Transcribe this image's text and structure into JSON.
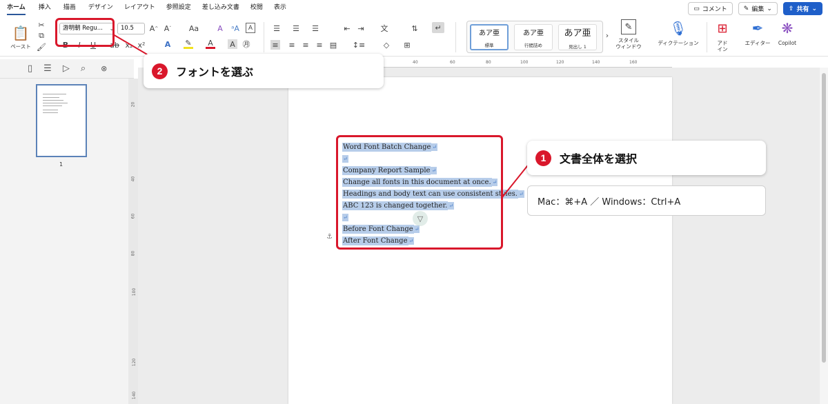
{
  "menu": {
    "tabs": [
      "ホーム",
      "挿入",
      "描画",
      "デザイン",
      "レイアウト",
      "参照設定",
      "差し込み文書",
      "校閲",
      "表示"
    ],
    "comment_label": "コメント",
    "edit_label": "編集",
    "share_label": "共有"
  },
  "ribbon": {
    "paste_label": "ペースト",
    "font_name": "游明朝 Regu...",
    "font_size": "10.5",
    "styles": [
      {
        "preview": "あア亜",
        "label": "標準"
      },
      {
        "preview": "あア亜",
        "label": "行間詰め"
      },
      {
        "preview": "あア亜",
        "label": "見出し 1"
      }
    ],
    "style_window_label": "スタイル\nウィンドウ",
    "dictation_label": "ディクテーション",
    "addin_label": "アド\nイン",
    "editor_label": "エディター",
    "copilot_label": "Copilot"
  },
  "sidebar": {
    "page_number": "1"
  },
  "ruler": {
    "h_ticks": [
      "40",
      "60",
      "80",
      "100",
      "120",
      "140",
      "160"
    ],
    "v_ticks": [
      "20",
      "40",
      "60",
      "80",
      "100",
      "120",
      "140"
    ]
  },
  "document": {
    "lines": [
      "Word Font Batch Change",
      "",
      "Company Report Sample",
      "Change all fonts in this document at once.",
      "Headings and body text can use consistent styles.",
      "ABC 123 is changed together.",
      "",
      "Before Font Change",
      "After Font Change"
    ]
  },
  "callouts": {
    "step1_num": "1",
    "step1_text": "文書全体を選択",
    "step1_shortcut": "Mac：⌘+A ／ Windows：Ctrl+A",
    "step2_num": "2",
    "step2_text": "フォントを選ぶ"
  },
  "colors": {
    "accent_red": "#d9172b",
    "selection_blue": "#b7cdea",
    "share_blue": "#1f5fc9"
  }
}
